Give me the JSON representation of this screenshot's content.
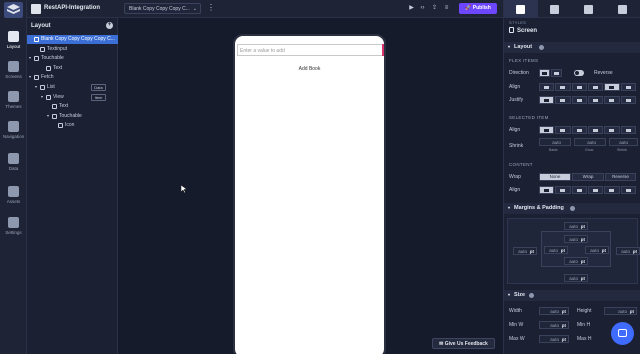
{
  "app": {
    "project_title": "RestAPI-Integration",
    "screen_select": "Blank Copy Copy Copy C..."
  },
  "rail": [
    {
      "label": "Layout",
      "icon": "layout-icon",
      "active": true
    },
    {
      "label": "Screens",
      "icon": "screens-icon"
    },
    {
      "label": "Themes",
      "icon": "themes-icon"
    },
    {
      "label": "Navigation",
      "icon": "navigation-icon"
    },
    {
      "label": "Data",
      "icon": "data-icon"
    },
    {
      "label": "Assets",
      "icon": "assets-icon"
    },
    {
      "label": "Settings",
      "icon": "settings-icon"
    }
  ],
  "topbar": {
    "publish_label": "Publish"
  },
  "layout_panel": {
    "title": "Layout",
    "tree": [
      {
        "label": "Blank Copy Copy Copy Copy C...",
        "indent": 0,
        "selected": true,
        "caret": false
      },
      {
        "label": "Textinput",
        "indent": 1,
        "caret": false
      },
      {
        "label": "Touchable",
        "indent": 0,
        "caret": true
      },
      {
        "label": "Text",
        "indent": 2,
        "caret": false
      },
      {
        "label": "Fetch",
        "indent": 0,
        "caret": true
      },
      {
        "label": "List",
        "indent": 1,
        "caret": true,
        "badge": "Data"
      },
      {
        "label": "View",
        "indent": 2,
        "caret": true,
        "badge": "Item"
      },
      {
        "label": "Text",
        "indent": 3,
        "caret": false
      },
      {
        "label": "Touchable",
        "indent": 3,
        "caret": true
      },
      {
        "label": "Icon",
        "indent": 4,
        "caret": false
      }
    ]
  },
  "canvas": {
    "input_placeholder": "Enter a value to add",
    "add_book_label": "Add Book",
    "feedback_label": "Give Us Feedback"
  },
  "inspector": {
    "styles_label": "STYLES",
    "screen_label": "Screen",
    "layout_section": "Layout",
    "flex_items_label": "FLEX ITEMS",
    "direction_label": "Direction",
    "reverse_label": "Reverse",
    "align_label": "Align",
    "justify_label": "Justify",
    "selected_item_label": "SELECTED ITEM",
    "align_self_label": "Align",
    "shrink_label": "Shrink",
    "basis_label": "Basis",
    "grow_label": "Grow",
    "shrink_sub_label": "Shrink",
    "content_label": "CONTENT",
    "wrap_label": "Wrap",
    "wrap_options": [
      "None",
      "Wrap",
      "Reverse"
    ],
    "content_align_label": "Align",
    "margins_section": "Margins & Padding",
    "size_section": "Size",
    "auto": "auto",
    "unit": "pt",
    "width_label": "Width",
    "height_label": "Height",
    "min_w_label": "Min W",
    "min_h_label": "Min H",
    "max_w_label": "Max W",
    "max_h_label": "Max H"
  },
  "colors": {
    "accent": "#6c47ff",
    "selection": "#3b6fd6",
    "chat": "#3f6bff"
  }
}
